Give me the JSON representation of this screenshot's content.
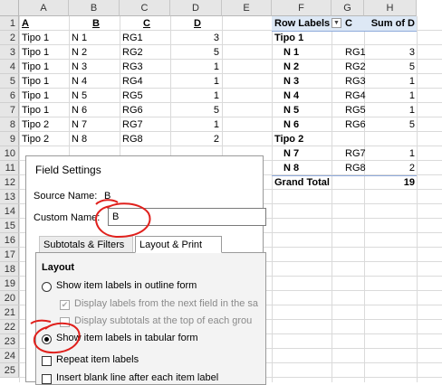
{
  "columns": [
    "A",
    "B",
    "C",
    "D",
    "E",
    "F",
    "G",
    "H"
  ],
  "rows": [
    "1",
    "2",
    "3",
    "4",
    "5",
    "6",
    "7",
    "8",
    "9",
    "10",
    "11",
    "12",
    "13",
    "14",
    "15",
    "16",
    "17",
    "18",
    "19",
    "20",
    "21",
    "22",
    "23",
    "24",
    "25"
  ],
  "table": {
    "headers": [
      "A",
      "B",
      "C",
      "D"
    ],
    "data": [
      [
        "Tipo 1",
        "N 1",
        "RG1",
        "3"
      ],
      [
        "Tipo 1",
        "N 2",
        "RG2",
        "5"
      ],
      [
        "Tipo 1",
        "N 3",
        "RG3",
        "1"
      ],
      [
        "Tipo 1",
        "N 4",
        "RG4",
        "1"
      ],
      [
        "Tipo 1",
        "N 5",
        "RG5",
        "1"
      ],
      [
        "Tipo 1",
        "N 6",
        "RG6",
        "5"
      ],
      [
        "Tipo 2",
        "N 7",
        "RG7",
        "1"
      ],
      [
        "Tipo 2",
        "N 8",
        "RG8",
        "2"
      ]
    ]
  },
  "pivot": {
    "header": {
      "row_labels": "Row Labels",
      "c": "C",
      "sum": "Sum of D"
    },
    "group1": {
      "label": "Tipo 1",
      "items": [
        [
          "N 1",
          "RG1",
          "3"
        ],
        [
          "N 2",
          "RG2",
          "5"
        ],
        [
          "N 3",
          "RG3",
          "1"
        ],
        [
          "N 4",
          "RG4",
          "1"
        ],
        [
          "N 5",
          "RG5",
          "1"
        ],
        [
          "N 6",
          "RG6",
          "5"
        ]
      ]
    },
    "group2": {
      "label": "Tipo 2",
      "items": [
        [
          "N 7",
          "RG7",
          "1"
        ],
        [
          "N 8",
          "RG8",
          "2"
        ]
      ]
    },
    "grand_total": {
      "label": "Grand Total",
      "value": "19"
    }
  },
  "dialog": {
    "title": "Field Settings",
    "source_name_label": "Source Name:",
    "source_name_value": "B",
    "custom_name_label": "Custom Name:",
    "custom_name_value": "B",
    "tabs": [
      "Subtotals & Filters",
      "Layout & Print"
    ],
    "layout_heading": "Layout",
    "opt_outline": "Show item labels in outline form",
    "opt_display_next": "Display labels from the next field in the sa",
    "opt_subtotals_top": "Display subtotals at the top of each grou",
    "opt_tabular": "Show item labels in tabular form",
    "opt_repeat": "Repeat item labels",
    "opt_blank_line": "Insert blank line after each item label"
  },
  "colors": {
    "annotation": "#e0201c",
    "pivot_header_bg": "#dde8f5",
    "pivot_line": "#8eaadb"
  }
}
